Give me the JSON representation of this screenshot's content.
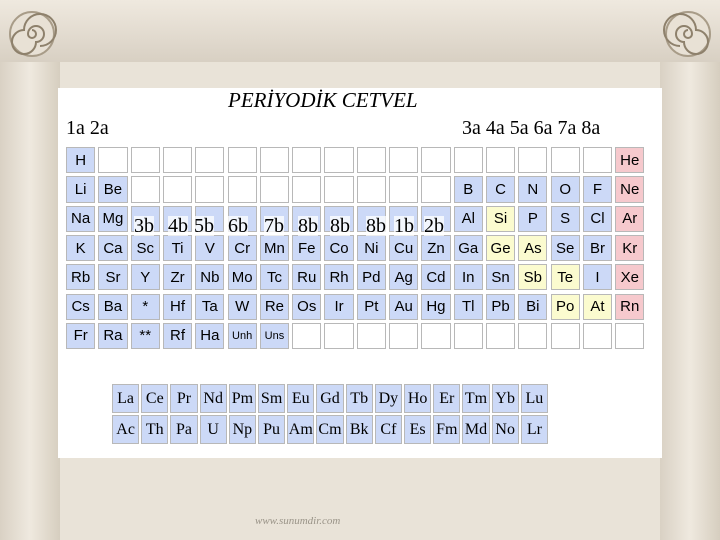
{
  "title": "PERİYODİK CETVEL",
  "group_labels": {
    "left": "1a  2a",
    "right": "3a 4a 5a 6a  7a 8a"
  },
  "subgroup_labels": [
    "3b",
    "4b",
    "5b",
    "6b",
    "7b",
    "8b",
    "8b",
    "8b",
    "1b",
    "2b"
  ],
  "rows": [
    [
      {
        "s": "H",
        "c": "blue"
      },
      {
        "s": "",
        "c": "empty"
      },
      {
        "s": "",
        "c": "empty"
      },
      {
        "s": "",
        "c": "empty"
      },
      {
        "s": "",
        "c": "empty"
      },
      {
        "s": "",
        "c": "empty"
      },
      {
        "s": "",
        "c": "empty"
      },
      {
        "s": "",
        "c": "empty"
      },
      {
        "s": "",
        "c": "empty"
      },
      {
        "s": "",
        "c": "empty"
      },
      {
        "s": "",
        "c": "empty"
      },
      {
        "s": "",
        "c": "empty"
      },
      {
        "s": "",
        "c": "empty"
      },
      {
        "s": "",
        "c": "empty"
      },
      {
        "s": "",
        "c": "empty"
      },
      {
        "s": "",
        "c": "empty"
      },
      {
        "s": "",
        "c": "empty"
      },
      {
        "s": "He",
        "c": "pink"
      }
    ],
    [
      {
        "s": "Li",
        "c": "blue"
      },
      {
        "s": "Be",
        "c": "blue"
      },
      {
        "s": "",
        "c": "empty"
      },
      {
        "s": "",
        "c": "empty"
      },
      {
        "s": "",
        "c": "empty"
      },
      {
        "s": "",
        "c": "empty"
      },
      {
        "s": "",
        "c": "empty"
      },
      {
        "s": "",
        "c": "empty"
      },
      {
        "s": "",
        "c": "empty"
      },
      {
        "s": "",
        "c": "empty"
      },
      {
        "s": "",
        "c": "empty"
      },
      {
        "s": "",
        "c": "empty"
      },
      {
        "s": "B",
        "c": "blue"
      },
      {
        "s": "C",
        "c": "blue"
      },
      {
        "s": "N",
        "c": "blue"
      },
      {
        "s": "O",
        "c": "blue"
      },
      {
        "s": "F",
        "c": "blue"
      },
      {
        "s": "Ne",
        "c": "pink"
      }
    ],
    [
      {
        "s": "Na",
        "c": "blue"
      },
      {
        "s": "Mg",
        "c": "blue"
      },
      {
        "s": "",
        "c": "blue"
      },
      {
        "s": "",
        "c": "blue"
      },
      {
        "s": "",
        "c": "blue"
      },
      {
        "s": "",
        "c": "blue"
      },
      {
        "s": "",
        "c": "blue"
      },
      {
        "s": "",
        "c": "blue"
      },
      {
        "s": "",
        "c": "blue"
      },
      {
        "s": "",
        "c": "blue"
      },
      {
        "s": "",
        "c": "blue"
      },
      {
        "s": "",
        "c": "blue"
      },
      {
        "s": "Al",
        "c": "blue"
      },
      {
        "s": "Si",
        "c": "yellow"
      },
      {
        "s": "P",
        "c": "blue"
      },
      {
        "s": "S",
        "c": "blue"
      },
      {
        "s": "Cl",
        "c": "blue"
      },
      {
        "s": "Ar",
        "c": "pink"
      }
    ],
    [
      {
        "s": "K",
        "c": "blue"
      },
      {
        "s": "Ca",
        "c": "blue"
      },
      {
        "s": "Sc",
        "c": "blue"
      },
      {
        "s": "Ti",
        "c": "blue"
      },
      {
        "s": "V",
        "c": "blue"
      },
      {
        "s": "Cr",
        "c": "blue"
      },
      {
        "s": "Mn",
        "c": "blue"
      },
      {
        "s": "Fe",
        "c": "blue"
      },
      {
        "s": "Co",
        "c": "blue"
      },
      {
        "s": "Ni",
        "c": "blue"
      },
      {
        "s": "Cu",
        "c": "blue"
      },
      {
        "s": "Zn",
        "c": "blue"
      },
      {
        "s": "Ga",
        "c": "blue"
      },
      {
        "s": "Ge",
        "c": "yellow"
      },
      {
        "s": "As",
        "c": "yellow"
      },
      {
        "s": "Se",
        "c": "blue"
      },
      {
        "s": "Br",
        "c": "blue"
      },
      {
        "s": "Kr",
        "c": "pink"
      }
    ],
    [
      {
        "s": "Rb",
        "c": "blue"
      },
      {
        "s": "Sr",
        "c": "blue"
      },
      {
        "s": "Y",
        "c": "blue"
      },
      {
        "s": "Zr",
        "c": "blue"
      },
      {
        "s": "Nb",
        "c": "blue"
      },
      {
        "s": "Mo",
        "c": "blue"
      },
      {
        "s": "Tc",
        "c": "blue"
      },
      {
        "s": "Ru",
        "c": "blue"
      },
      {
        "s": "Rh",
        "c": "blue"
      },
      {
        "s": "Pd",
        "c": "blue"
      },
      {
        "s": "Ag",
        "c": "blue"
      },
      {
        "s": "Cd",
        "c": "blue"
      },
      {
        "s": "In",
        "c": "blue"
      },
      {
        "s": "Sn",
        "c": "blue"
      },
      {
        "s": "Sb",
        "c": "yellow"
      },
      {
        "s": "Te",
        "c": "yellow"
      },
      {
        "s": "I",
        "c": "blue"
      },
      {
        "s": "Xe",
        "c": "pink"
      }
    ],
    [
      {
        "s": "Cs",
        "c": "blue"
      },
      {
        "s": "Ba",
        "c": "blue"
      },
      {
        "s": "*",
        "c": "blue"
      },
      {
        "s": "Hf",
        "c": "blue"
      },
      {
        "s": "Ta",
        "c": "blue"
      },
      {
        "s": "W",
        "c": "blue"
      },
      {
        "s": "Re",
        "c": "blue"
      },
      {
        "s": "Os",
        "c": "blue"
      },
      {
        "s": "Ir",
        "c": "blue"
      },
      {
        "s": "Pt",
        "c": "blue"
      },
      {
        "s": "Au",
        "c": "blue"
      },
      {
        "s": "Hg",
        "c": "blue"
      },
      {
        "s": "Tl",
        "c": "blue"
      },
      {
        "s": "Pb",
        "c": "blue"
      },
      {
        "s": "Bi",
        "c": "blue"
      },
      {
        "s": "Po",
        "c": "yellow"
      },
      {
        "s": "At",
        "c": "yellow"
      },
      {
        "s": "Rn",
        "c": "pink"
      }
    ],
    [
      {
        "s": "Fr",
        "c": "blue"
      },
      {
        "s": "Ra",
        "c": "blue"
      },
      {
        "s": "**",
        "c": "blue"
      },
      {
        "s": "Rf",
        "c": "blue"
      },
      {
        "s": "Ha",
        "c": "blue"
      },
      {
        "s": "Unh",
        "c": "blue",
        "small": true
      },
      {
        "s": "Uns",
        "c": "blue",
        "small": true
      },
      {
        "s": "",
        "c": "empty"
      },
      {
        "s": "",
        "c": "empty"
      },
      {
        "s": "",
        "c": "empty"
      },
      {
        "s": "",
        "c": "empty"
      },
      {
        "s": "",
        "c": "empty"
      },
      {
        "s": "",
        "c": "empty"
      },
      {
        "s": "",
        "c": "empty"
      },
      {
        "s": "",
        "c": "empty"
      },
      {
        "s": "",
        "c": "empty"
      },
      {
        "s": "",
        "c": "empty"
      },
      {
        "s": "",
        "c": "empty"
      }
    ]
  ],
  "lanthanides": [
    "La",
    "Ce",
    "Pr",
    "Nd",
    "Pm",
    "Sm",
    "Eu",
    "Gd",
    "Tb",
    "Dy",
    "Ho",
    "Er",
    "Tm",
    "Yb",
    "Lu"
  ],
  "actinides": [
    "Ac",
    "Th",
    "Pa",
    "U",
    "Np",
    "Pu",
    "Am",
    "Cm",
    "Bk",
    "Cf",
    "Es",
    "Fm",
    "Md",
    "No",
    "Lr"
  ],
  "watermark": "www.sunumdir.com",
  "colors": {
    "metal": "#ccd9f7",
    "metalloid": "#fbfbcf",
    "noble_gas": "#f6c9cd"
  }
}
